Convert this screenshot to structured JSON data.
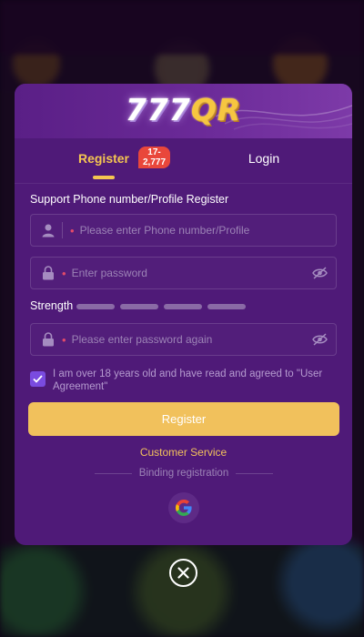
{
  "logo": {
    "part1": "777",
    "part2": "QR"
  },
  "tabs": [
    {
      "label": "Register",
      "active": true,
      "badge": "17-2,777"
    },
    {
      "label": "Login",
      "active": false
    }
  ],
  "form": {
    "section_title": "Support Phone number/Profile Register",
    "phone_placeholder": "Please enter Phone number/Profile",
    "password_placeholder": "Enter password",
    "confirm_placeholder": "Please enter password again",
    "strength_label": "Strength",
    "strength_level": 0,
    "agreement_checked": true,
    "agreement_text": "I am over 18 years old and have read and agreed to \"User Agreement\"",
    "register_button": "Register",
    "customer_service": "Customer Service",
    "binding_text": "Binding registration"
  },
  "icons": {
    "user": "user-icon",
    "lock": "lock-icon",
    "eye_off": "eye-off-icon",
    "check": "check-icon",
    "google": "google-icon",
    "close": "close-icon"
  },
  "colors": {
    "modal_bg": "#4f1a78",
    "accent_gold": "#f1c15c",
    "checkbox": "#7a4be0",
    "badge": "#e9473b"
  }
}
